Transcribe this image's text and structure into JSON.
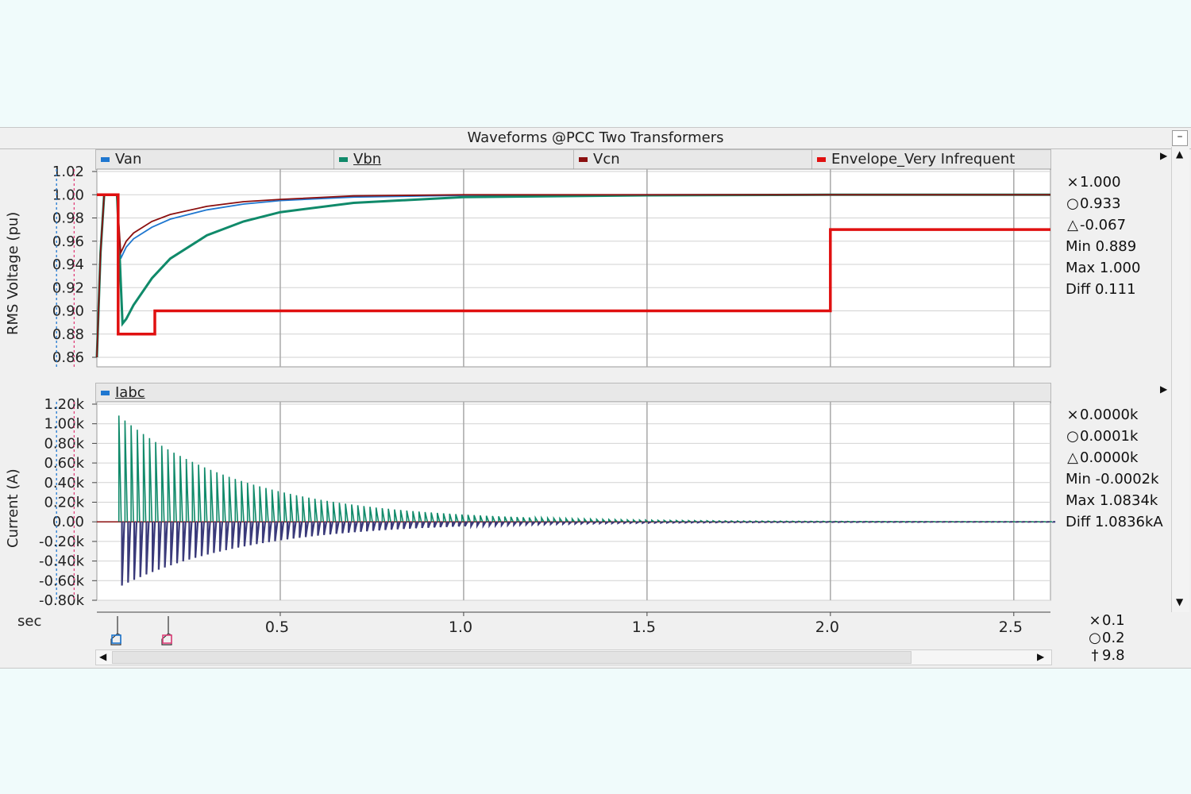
{
  "window": {
    "title": "Waveforms @PCC  Two Transformers",
    "min_icon": "minimize-icon"
  },
  "time_axis": {
    "unit_label": "sec",
    "ticks": [
      "0.5",
      "1.0",
      "1.5",
      "2.0",
      "2.5"
    ],
    "readout": [
      {
        "symbol": "×",
        "value": "0.1"
      },
      {
        "symbol": "○",
        "value": "0.2"
      },
      {
        "symbol": "†",
        "value": "9.8"
      }
    ]
  },
  "voltage_panel": {
    "legend": [
      {
        "name": "Van",
        "color": "#1f77d0"
      },
      {
        "name": "Vbn",
        "color": "#108a6a"
      },
      {
        "name": "Vcn",
        "color": "#8b0f0f"
      },
      {
        "name": "Envelope_Very Infrequent",
        "color": "#e01010"
      }
    ],
    "readout": [
      {
        "symbol": "×",
        "value": "1.000"
      },
      {
        "symbol": "○",
        "value": "0.933"
      },
      {
        "symbol": "△",
        "value": "-0.067"
      },
      {
        "symbol": "",
        "value": "Min 0.889"
      },
      {
        "symbol": "",
        "value": "Max 1.000"
      },
      {
        "symbol": "",
        "value": "Diff 0.111"
      }
    ]
  },
  "current_panel": {
    "legend": [
      {
        "name": "Iabc",
        "color": "#1f77d0"
      }
    ],
    "readout": [
      {
        "symbol": "×",
        "value": "0.0000k"
      },
      {
        "symbol": "○",
        "value": "0.0001k"
      },
      {
        "symbol": "△",
        "value": "0.0000k"
      },
      {
        "symbol": "",
        "value": "Min -0.0002k"
      },
      {
        "symbol": "",
        "value": "Max 1.0834k"
      },
      {
        "symbol": "",
        "value": "Diff 1.0836kA"
      }
    ]
  },
  "chart_data": [
    {
      "type": "line",
      "title": "Waveforms @PCC  Two Transformers",
      "ylabel": "RMS Voltage (pu)",
      "xlabel": "sec",
      "xlim": [
        0,
        2.6
      ],
      "ylim": [
        0.85,
        1.02
      ],
      "yticks": [
        "1.02",
        "1.00",
        "0.98",
        "0.96",
        "0.94",
        "0.92",
        "0.90",
        "0.88",
        "0.86"
      ],
      "ytick_values": [
        1.02,
        1.0,
        0.98,
        0.96,
        0.94,
        0.92,
        0.9,
        0.88,
        0.86
      ],
      "xticks": [
        0.5,
        1.0,
        1.5,
        2.0,
        2.5
      ],
      "cursors": [
        0.1,
        0.2
      ],
      "series": [
        {
          "name": "Van",
          "color": "#1f77d0",
          "x": [
            0.0,
            0.01,
            0.02,
            0.055,
            0.065,
            0.08,
            0.1,
            0.15,
            0.2,
            0.3,
            0.4,
            0.5,
            0.7,
            1.0,
            1.5,
            2.0,
            2.6
          ],
          "y": [
            0.86,
            0.95,
            1.0,
            1.0,
            0.945,
            0.955,
            0.962,
            0.972,
            0.979,
            0.987,
            0.992,
            0.995,
            0.998,
            0.9995,
            1.0,
            1.0,
            1.0
          ]
        },
        {
          "name": "Vbn",
          "color": "#108a6a",
          "x": [
            0.0,
            0.01,
            0.02,
            0.055,
            0.07,
            0.08,
            0.1,
            0.15,
            0.2,
            0.3,
            0.4,
            0.5,
            0.7,
            1.0,
            1.5,
            2.0,
            2.6
          ],
          "y": [
            0.86,
            0.95,
            1.0,
            1.0,
            0.889,
            0.893,
            0.905,
            0.928,
            0.945,
            0.965,
            0.977,
            0.985,
            0.993,
            0.998,
            0.9995,
            1.0,
            1.0
          ]
        },
        {
          "name": "Vcn",
          "color": "#8b0f0f",
          "x": [
            0.0,
            0.01,
            0.02,
            0.055,
            0.065,
            0.08,
            0.1,
            0.15,
            0.2,
            0.3,
            0.4,
            0.5,
            0.7,
            1.0,
            1.5,
            2.0,
            2.6
          ],
          "y": [
            0.86,
            0.95,
            1.0,
            1.0,
            0.95,
            0.96,
            0.967,
            0.977,
            0.983,
            0.99,
            0.994,
            0.996,
            0.999,
            1.0,
            1.0,
            1.0,
            1.0
          ]
        },
        {
          "name": "Envelope_Very Infrequent",
          "color": "#e01010",
          "x": [
            0.0,
            0.058,
            0.058,
            0.158,
            0.158,
            2.0,
            2.0,
            2.6
          ],
          "y": [
            1.0,
            1.0,
            0.88,
            0.88,
            0.9,
            0.9,
            0.97,
            0.97
          ]
        }
      ]
    },
    {
      "type": "line",
      "ylabel": "Current (A)",
      "xlabel": "sec",
      "xlim": [
        0,
        2.6
      ],
      "ylim": [
        -0.8,
        1.2
      ],
      "yticks": [
        "1.20k",
        "1.00k",
        "0.80k",
        "0.60k",
        "0.40k",
        "0.20k",
        "0.00",
        "-0.20k",
        "-0.40k",
        "-0.60k",
        "-0.80k"
      ],
      "ytick_values": [
        1.2,
        1.0,
        0.8,
        0.6,
        0.4,
        0.2,
        0.0,
        -0.2,
        -0.4,
        -0.6,
        -0.8
      ],
      "xticks": [
        0.5,
        1.0,
        1.5,
        2.0,
        2.5
      ],
      "cursors": [
        0.1,
        0.2
      ],
      "series": [
        {
          "name": "Iabc",
          "color": "#108a6a",
          "peak_start_kA": 1.0834,
          "peak_neg_start_kA": -0.65,
          "inrush_start_sec": 0.06,
          "period_sec": 0.0167,
          "decay_tau_sec": 0.35
        }
      ]
    }
  ]
}
